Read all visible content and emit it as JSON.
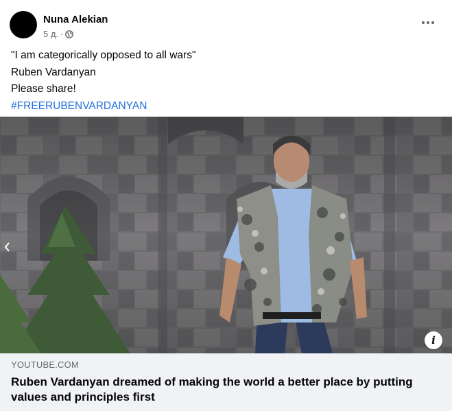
{
  "post": {
    "author": "Nuna Alekian",
    "time": "5 д.",
    "dot": "·",
    "privacy_icon": "globe-icon",
    "more_icon": "more-options-icon",
    "lines": [
      "\"I am categorically opposed to all wars\"",
      "Ruben Vardanyan",
      "Please share!"
    ],
    "hashtag": "#FREERUBENVARDANYAN"
  },
  "media": {
    "prev_icon": "chevron-left-icon",
    "info_label": "i"
  },
  "link": {
    "domain": "YOUTUBE.COM",
    "title": "Ruben Vardanyan dreamed of making the world a better place by putting values and principles first"
  },
  "colors": {
    "hashtag": "#216fdb",
    "meta": "#65676b",
    "link_bg": "#f0f2f5"
  }
}
